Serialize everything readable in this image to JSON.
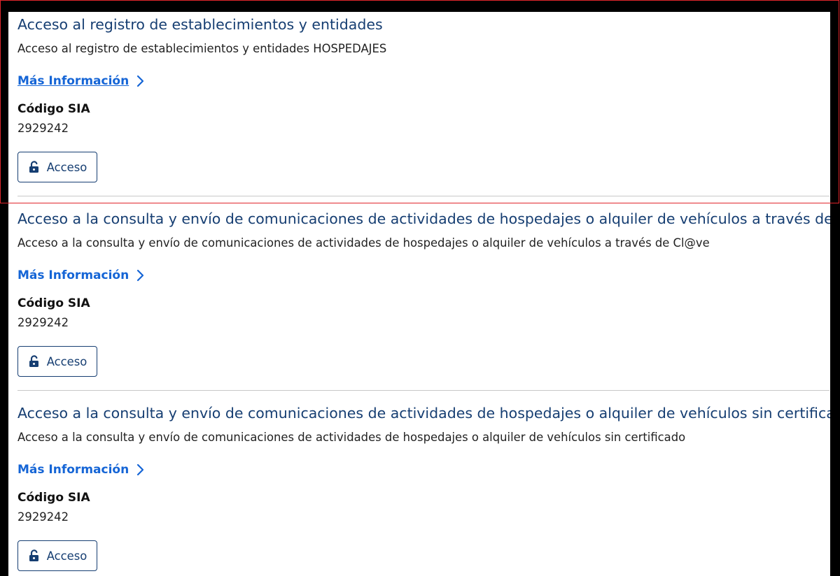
{
  "items": [
    {
      "title": "Acceso al registro de establecimientos y entidades",
      "description": "Acceso al registro de establecimientos y entidades HOSPEDAJES",
      "more_info": "Más Información",
      "code_label": "Código SIA",
      "code_value": "2929242",
      "button_label": "Acceso"
    },
    {
      "title": "Acceso a la consulta y envío de comunicaciones de actividades de hospedajes o alquiler de vehículos a través de Cl@ve",
      "description": "Acceso a la consulta y envío de comunicaciones de actividades de hospedajes o alquiler de vehículos a través de Cl@ve",
      "more_info": "Más Información",
      "code_label": "Código SIA",
      "code_value": "2929242",
      "button_label": "Acceso"
    },
    {
      "title": "Acceso a la consulta y envío de comunicaciones de actividades de hospedajes o alquiler de vehículos sin certificado",
      "description": "Acceso a la consulta y envío de comunicaciones de actividades de hospedajes o alquiler de vehículos sin certificado",
      "more_info": "Más Información",
      "code_label": "Código SIA",
      "code_value": "2929242",
      "button_label": "Acceso"
    }
  ],
  "icons": {
    "more_info": "chevron-right-icon",
    "access_button": "unlock-icon"
  },
  "colors": {
    "title": "#163e72",
    "link": "#1565d6",
    "highlight_border": "#e0252b",
    "divider": "#c8c8c8",
    "background_outer": "#000000",
    "panel": "#ffffff"
  }
}
